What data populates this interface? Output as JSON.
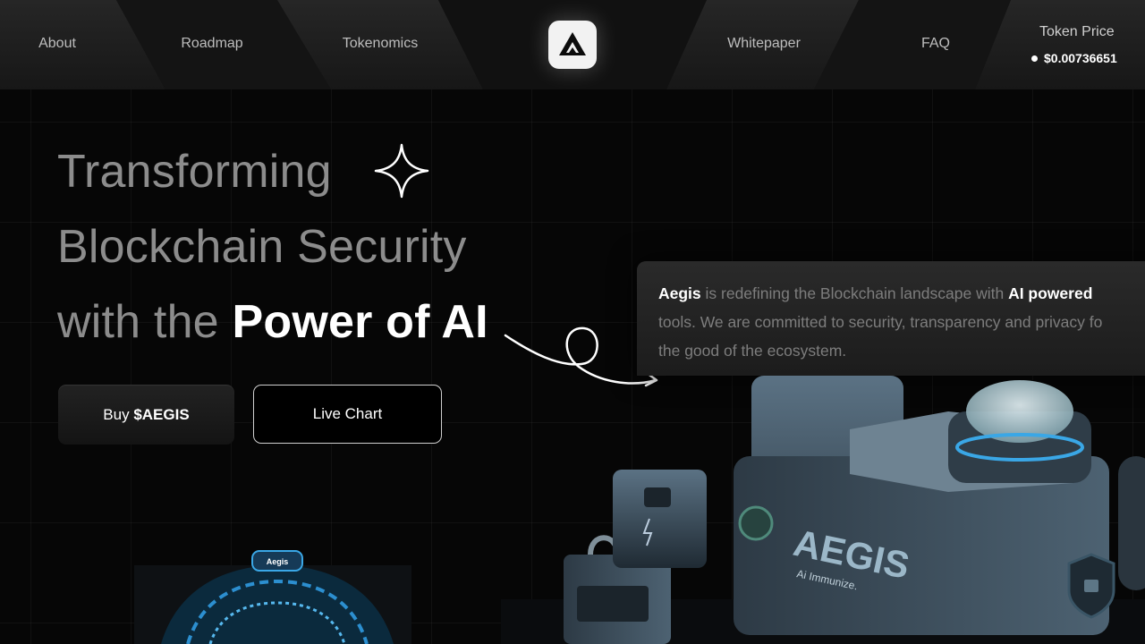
{
  "nav": {
    "links": [
      "About",
      "Roadmap",
      "Tokenomics",
      "Whitepaper",
      "FAQ"
    ],
    "token_price_label": "Token Price",
    "token_price_value": "$0.00736651"
  },
  "hero": {
    "line1": "Transforming",
    "line2": "Blockchain Security",
    "line3_prefix": "with the ",
    "line3_strong": "Power of AI"
  },
  "buttons": {
    "buy_prefix": "Buy ",
    "buy_strong": "$AEGIS",
    "live_chart": "Live Chart"
  },
  "description": {
    "brand": "Aegis",
    "text1": " is redefining the Blockchain landscape with ",
    "highlight": "AI powered",
    "line2": "tools. We are committed to security, transparency and privacy fo",
    "line3": "the good of the ecosystem."
  },
  "illustration": {
    "machine_label": "AEGIS",
    "machine_sublabel": "Ai Immunize.",
    "device_label": "Aegis"
  },
  "colors": {
    "background": "#060606",
    "nav_panel": "#1d1d1d",
    "accent_blue": "#3aa7e6"
  },
  "icons": [
    "logo-icon",
    "sparkle-icon",
    "swirl-arrow-icon",
    "price-dot-icon"
  ]
}
